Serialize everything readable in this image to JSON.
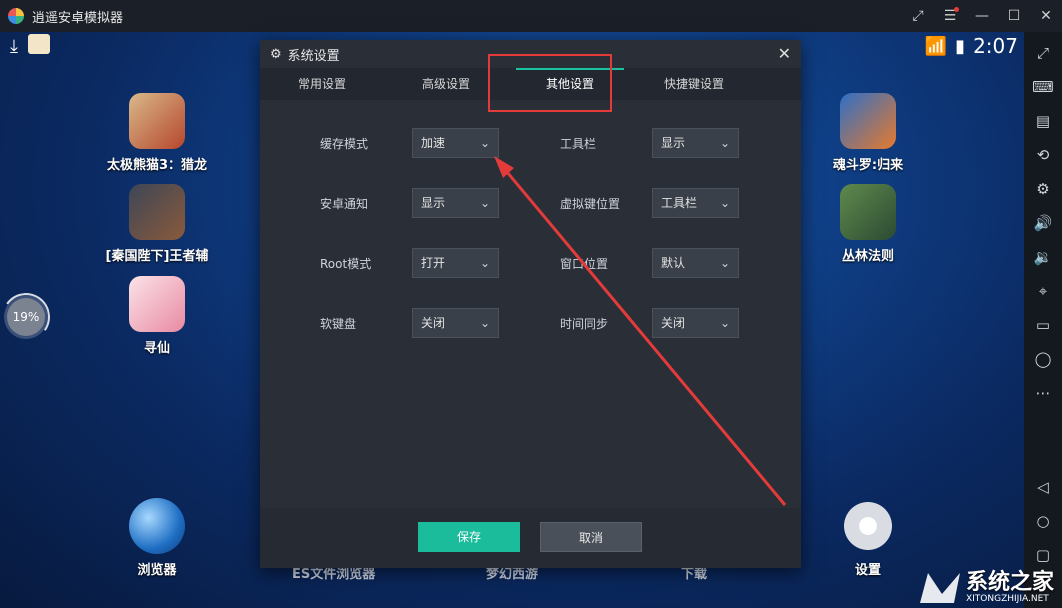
{
  "window": {
    "title": "逍遥安卓模拟器"
  },
  "status": {
    "time": "2:07"
  },
  "progress": {
    "label": "19%",
    "value": 19
  },
  "apps_left": [
    {
      "label": "太极熊猫3：猎龙"
    },
    {
      "label": "[秦国陛下]王者辅"
    },
    {
      "label": "寻仙"
    }
  ],
  "apps_right": [
    {
      "label": "魂斗罗:归来"
    },
    {
      "label": "丛林法则"
    }
  ],
  "dock": {
    "browser": "浏览器",
    "settings": "设置",
    "partial_1": "ES文件浏览器",
    "partial_2": "梦幻西游",
    "partial_3": "下载"
  },
  "dialog": {
    "title": "系统设置",
    "tabs": [
      "常用设置",
      "高级设置",
      "其他设置",
      "快捷键设置"
    ],
    "active_tab": "其他设置",
    "settings": {
      "cache_mode": {
        "label": "缓存模式",
        "value": "加速"
      },
      "android_notify": {
        "label": "安卓通知",
        "value": "显示"
      },
      "root_mode": {
        "label": "Root模式",
        "value": "打开"
      },
      "soft_keyboard": {
        "label": "软键盘",
        "value": "关闭"
      },
      "toolbar": {
        "label": "工具栏",
        "value": "显示"
      },
      "virtual_key_pos": {
        "label": "虚拟键位置",
        "value": "工具栏"
      },
      "window_pos": {
        "label": "窗口位置",
        "value": "默认"
      },
      "time_sync": {
        "label": "时间同步",
        "value": "关闭"
      }
    },
    "buttons": {
      "save": "保存",
      "cancel": "取消"
    }
  },
  "watermark": {
    "text": "系统之家",
    "url": "XITONGZHIJIA.NET"
  },
  "colors": {
    "accent": "#1abc9c",
    "highlight": "#e33a3a"
  }
}
